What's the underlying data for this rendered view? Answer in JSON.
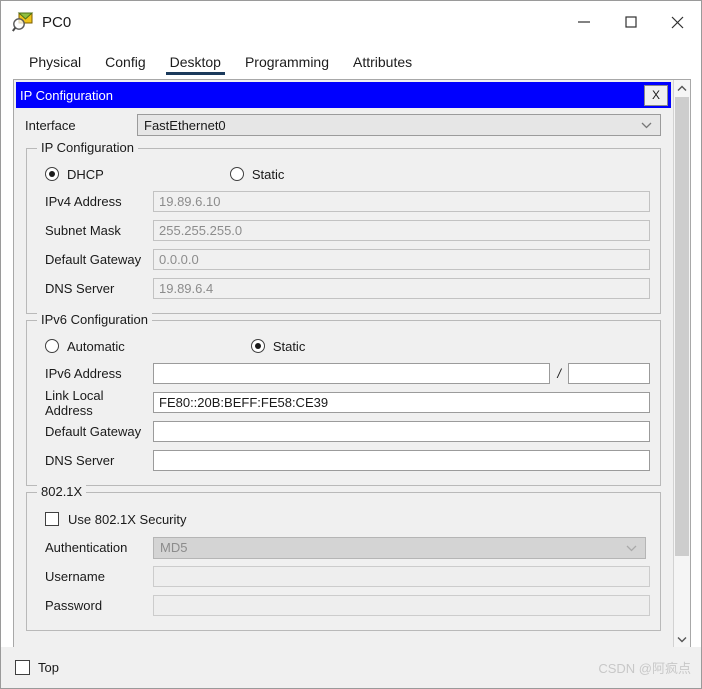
{
  "window": {
    "title": "PC0",
    "icon": "packet-tracer-pc-icon",
    "minimize_label": "—",
    "maximize_label": "□",
    "close_label": "✕"
  },
  "tabs": [
    {
      "label": "Physical",
      "active": false
    },
    {
      "label": "Config",
      "active": false
    },
    {
      "label": "Desktop",
      "active": true
    },
    {
      "label": "Programming",
      "active": false
    },
    {
      "label": "Attributes",
      "active": false
    }
  ],
  "panel": {
    "header_title": "IP Configuration",
    "close_button": "X",
    "accent_color": "#0000ff"
  },
  "interface": {
    "label": "Interface",
    "value": "FastEthernet0"
  },
  "ipv4": {
    "legend": "IP Configuration",
    "mode_dhcp": {
      "label": "DHCP",
      "selected": true
    },
    "mode_static": {
      "label": "Static",
      "selected": false
    },
    "fields": [
      {
        "label": "IPv4 Address",
        "value": "19.89.6.10"
      },
      {
        "label": "Subnet Mask",
        "value": "255.255.255.0"
      },
      {
        "label": "Default Gateway",
        "value": "0.0.0.0"
      },
      {
        "label": "DNS Server",
        "value": "19.89.6.4"
      }
    ]
  },
  "ipv6": {
    "legend": "IPv6 Configuration",
    "mode_automatic": {
      "label": "Automatic",
      "selected": false
    },
    "mode_static": {
      "label": "Static",
      "selected": true
    },
    "address_label": "IPv6 Address",
    "address_value": "",
    "prefix_separator": "/",
    "prefix_value": "",
    "fields": [
      {
        "label": "Link Local Address",
        "value": "FE80::20B:BEFF:FE58:CE39"
      },
      {
        "label": "Default Gateway",
        "value": ""
      },
      {
        "label": "DNS Server",
        "value": ""
      }
    ]
  },
  "dot1x": {
    "legend": "802.1X",
    "use_security": {
      "label": "Use 802.1X Security",
      "checked": false
    },
    "authentication": {
      "label": "Authentication",
      "value": "MD5"
    },
    "username": {
      "label": "Username",
      "value": ""
    },
    "password": {
      "label": "Password",
      "value": ""
    }
  },
  "bottom": {
    "top_checkbox": {
      "label": "Top",
      "checked": false
    },
    "watermark": "CSDN @阿疯点"
  }
}
